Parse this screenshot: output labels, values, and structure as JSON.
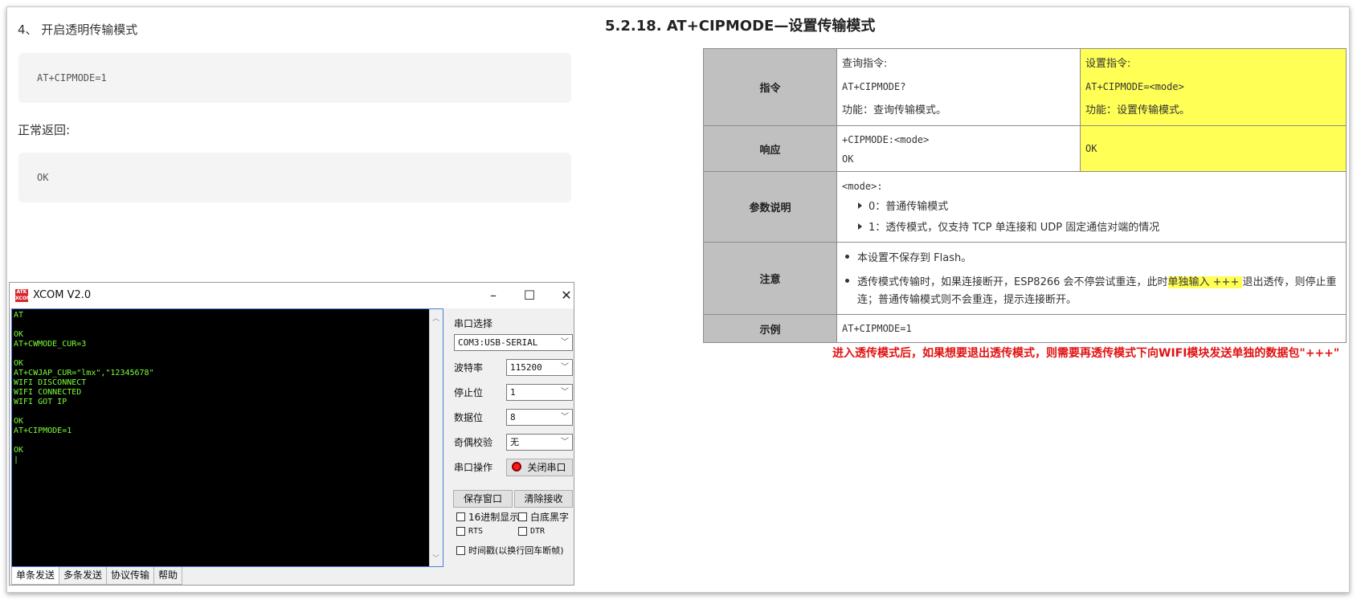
{
  "left_doc": {
    "step_title": "4、 开启透明传输模式",
    "code1": "AT+CIPMODE=1",
    "normal_return": "正常返回:",
    "code2": "OK"
  },
  "xcom": {
    "logo": "ATK XCOM",
    "title": "XCOM V2.0",
    "terminal_text": "AT\n\nOK\nAT+CWMODE_CUR=3\n\nOK\nAT+CWJAP_CUR=\"lmx\",\"12345678\"\nWIFI DISCONNECT\nWIFI CONNECTED\nWIFI GOT IP\n\nOK\nAT+CIPMODE=1\n\nOK\n|",
    "port_select_label": "串口选择",
    "port_value": "COM3:USB-SERIAL",
    "baud_label": "波特率",
    "baud_value": "115200",
    "stop_label": "停止位",
    "stop_value": "1",
    "data_label": "数据位",
    "data_value": "8",
    "parity_label": "奇偶校验",
    "parity_value": "无",
    "port_op_label": "串口操作",
    "close_port_label": "关闭串口",
    "save_window_label": "保存窗口",
    "clear_receive_label": "清除接收",
    "hex_display_label": "16进制显示",
    "white_bg_label": "白底黑字",
    "rts_label": "RTS",
    "dtr_label": "DTR",
    "timestamp_label": "时间戳(以换行回车断帧)",
    "tabs": [
      "单条发送",
      "多条发送",
      "协议传输",
      "帮助"
    ]
  },
  "right_doc": {
    "heading": "5.2.18.  AT+CIPMODE—设置传输模式",
    "table": {
      "cmd_header": "指令",
      "query_label": "查询指令:",
      "query_cmd": "AT+CIPMODE?",
      "query_func": "功能：查询传输模式。",
      "set_label": "设置指令:",
      "set_cmd": "AT+CIPMODE=<mode>",
      "set_func": "功能：设置传输模式。",
      "resp_header": "响应",
      "resp_line1": "+CIPMODE:<mode>",
      "resp_line2": "OK",
      "set_resp": "OK",
      "param_header": "参数说明",
      "param_title": "<mode>:",
      "param_0": "0：普通传输模式",
      "param_1": "1：透传模式，仅支持 TCP 单连接和 UDP 固定通信对端的情况",
      "note_header": "注意",
      "note1": "本设置不保存到 Flash。",
      "note2_a": "透传模式传输时，如果连接断开，ESP8266 会不停尝试重连，此时",
      "note2_hl": "单独输入 +++ ",
      "note2_b": "退出透传，则停止重连；普通传输模式则不会重连，提示连接断开。",
      "example_header": "示例",
      "example": "AT+CIPMODE=1"
    },
    "red_note": "进入透传模式后，如果想要退出透传模式，则需要再透传模式下向WIFI模块发送单独的数据包\"+++\""
  }
}
